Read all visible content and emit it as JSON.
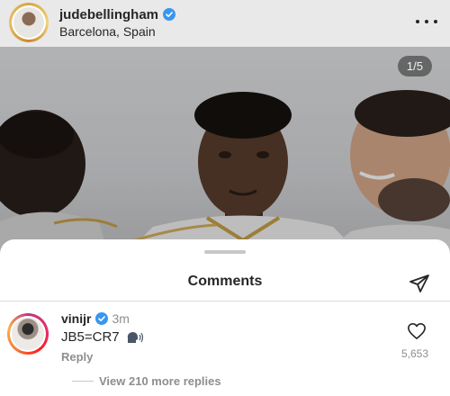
{
  "post": {
    "username": "judebellingham",
    "location": "Barcelona, Spain",
    "slide_counter": "1/5"
  },
  "comments_sheet": {
    "title": "Comments",
    "comment": {
      "username": "vinijr",
      "time": "3m",
      "text": "JB5=CR7",
      "reply_label": "Reply",
      "like_count": "5,653"
    },
    "view_replies_label": "View 210 more replies"
  },
  "icons": {
    "verified": "verified-badge-icon",
    "more": "more-options-icon",
    "share": "share-send-icon",
    "speaker": "speaking-head-icon",
    "like": "heart-icon"
  },
  "colors": {
    "verified_blue": "#3897f0",
    "text_primary": "#262626",
    "text_secondary": "#8e8e8e"
  }
}
